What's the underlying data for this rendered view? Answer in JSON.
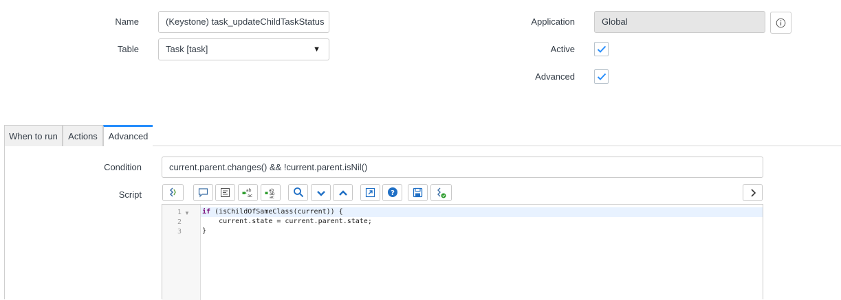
{
  "form": {
    "name_label": "Name",
    "name_value": "(Keystone) task_updateChildTaskStatus",
    "table_label": "Table",
    "table_value": "Task [task]",
    "application_label": "Application",
    "application_value": "Global",
    "active_label": "Active",
    "active_checked": true,
    "advanced_label": "Advanced",
    "advanced_checked": true
  },
  "tabs": [
    {
      "label": "When to run",
      "active": false
    },
    {
      "label": "Actions",
      "active": false
    },
    {
      "label": "Advanced",
      "active": true
    }
  ],
  "advanced": {
    "condition_label": "Condition",
    "condition_value": "current.parent.changes() && !current.parent.isNil()",
    "script_label": "Script"
  },
  "toolbar": {
    "icons": [
      "format-code-icon",
      "comment-icon",
      "align-icon",
      "replace-icon",
      "replace-all-icon",
      "search-icon",
      "next-icon",
      "previous-icon",
      "fullscreen-icon",
      "help-icon",
      "save-icon",
      "script-debugger-icon",
      "expand-panel-icon"
    ]
  },
  "editor": {
    "lines": [
      {
        "num": "1",
        "keyword": "if",
        "text": " (isChildOfSameClass(current)) {"
      },
      {
        "num": "2",
        "keyword": "",
        "text": "    current.state = current.parent.state;"
      },
      {
        "num": "3",
        "keyword": "",
        "text": "}"
      }
    ]
  },
  "colors": {
    "accent": "#278efc",
    "checkbox": "#278efc"
  }
}
